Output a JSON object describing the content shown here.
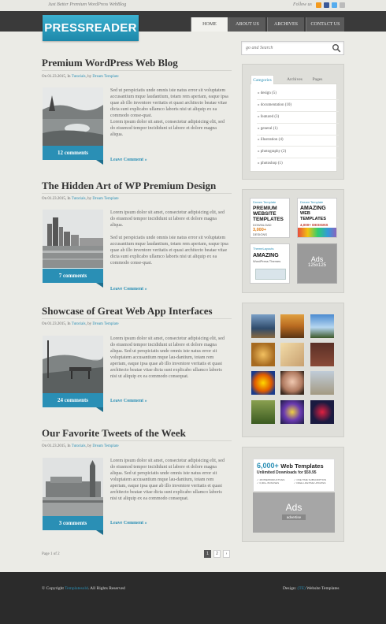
{
  "topbar": {
    "tagline": "Just Better Premium WordPress WebBlog",
    "follow_label": "Follow us"
  },
  "header": {
    "logo": "PRESSREADER",
    "nav": [
      {
        "label": "HOME"
      },
      {
        "label": "ABOUT US"
      },
      {
        "label": "ARCHIVES"
      },
      {
        "label": "CONTACT US"
      }
    ]
  },
  "search": {
    "placeholder": "go and Search"
  },
  "posts": [
    {
      "title": "Premium WordPress Web Blog",
      "date": "On 01.23.2015, In",
      "category": "Tutorials",
      "by": ", by",
      "author": "Dream Template",
      "comments": "12 comments",
      "paragraphs": [
        "Sed ut perspiciatis unde omnis iste natus error sit voluptatem accusantium mque laudantium, totam rem aperiam, eaque ipsa quae ab illo inventore veritatis et quasi architecto beatae vitae dicta sunt explicabo ullamco laboris nisi ut aliquip ex ea commodo conse-quat.",
        "Lorem ipsum dolor sit amet, consectetur adipisicing elit, sed do eiusmod tempor incididunt ut labore et dolore magna aliqua."
      ],
      "leave": "Leave Comment »"
    },
    {
      "title": "The Hidden Art of WP Premium Design",
      "date": "On 01.23.2015, In",
      "category": "Tutorials",
      "by": ", by",
      "author": "Dream Template",
      "comments": "7 comments",
      "paragraphs": [
        "Lorem ipsum dolor sit amet, consectetur adipisicing elit, sed do eiusmod tempor incididunt ut labore et dolore magna aliqua.",
        "Sed ut perspiciatis unde omnis iste natus error sit voluptatem accusantium mque laudantium, totam rem aperiam, eaque ipsa quae ab illo inventore veritatis et quasi architecto beatae vitae dicta sunt explicabo ullamco laboris nisi ut aliquip ex ea commodo conse-quat."
      ],
      "leave": "Leave Comment »"
    },
    {
      "title": "Showcase of Great Web App Interfaces",
      "date": "On 01.23.2015, In",
      "category": "Tutorials",
      "by": ", by",
      "author": "Dream Template",
      "comments": "24 comments",
      "paragraphs": [
        "Lorem ipsum dolor sit amet, consectetur adipisicing elit, sed do eiusmod tempor incididunt ut labore et dolore magna aliqua. Sed ut perspiciatis unde omnis iste natus error sit voluptatem accusantium mque lau-dantium, totam rem aperiam, eaque ipsa quae ab illo inventore veritatis et quasi architecto beatae vitae dicta sunt explicabo ullamco laboris nisi ut aliquip ex ea commodo consequat."
      ],
      "leave": "Leave Comment »"
    },
    {
      "title": "Our Favorite Tweets of the Week",
      "date": "On 01.23.2015, In",
      "category": "Tutorials",
      "by": ", by",
      "author": "Dream Template",
      "comments": "3 comments",
      "paragraphs": [
        "Lorem ipsum dolor sit amet, consectetur adipisicing elit, sed do eiusmod tempor incididunt ut labore et dolore magna aliqua. Sed ut perspiciatis unde omnis iste natus error sit voluptatem accusantium mque lau-dantium, totam rem aperiam, eaque ipsa quae ab illo inventore veritatis et quasi architecto beatae vitae dicta sunt explicabo ullamco laboris nisi ut aliquip ex ea commodo consequat."
      ],
      "leave": "Leave Comment »"
    }
  ],
  "pagination": {
    "info": "Page 1 of 2",
    "pages": [
      "1",
      "2",
      "›"
    ]
  },
  "sidebar": {
    "tabs": [
      "Categories",
      "Archives",
      "Pages"
    ],
    "categories": [
      "» design (5)",
      "» documentation (10)",
      "» featured (3)",
      "» general (1)",
      "» illustration (4)",
      "» photography (2)",
      "» photoshop (1)"
    ],
    "ads": [
      {
        "small": "Dream Template",
        "lines": [
          "PREMIUM",
          "WEBSITE",
          "TEMPLATES"
        ],
        "sub": "DOWNLOAD",
        "num": "3,000+",
        "tail": "DESIGNS"
      },
      {
        "small": "Dream Template",
        "lines": [
          "AMAZING",
          "WEB TEMPLATES"
        ],
        "num": "4,000+ DESIGNS",
        "sub": "UNLIMITED DOWNLOADS"
      },
      {
        "small": "ThemeLayouts",
        "lines": [
          "AMAZING"
        ],
        "sub": "WordPress Themes"
      },
      {
        "label": "Ads",
        "size": "125x125"
      }
    ],
    "banner": {
      "headline_num": "6,000+",
      "headline": "Web Templates",
      "sub": "Unlimited Downloads for $59.95",
      "fine": [
        "✓ 48 PREPRODUCTIVES",
        "✓ 6,000+ BONUSES",
        "✓ ONE TIME SUBSCRIPTION",
        "✓ FREE LIFETIME UPDATES"
      ],
      "ads_label": "Ads",
      "advertise": "advertise"
    }
  },
  "footer": {
    "copy_prefix": "© Copyright",
    "copy_link": "Templatesold",
    "copy_suffix": ". All Rights Reserved",
    "design_prefix": "Design:",
    "design_link": "(TE)",
    "design_suffix": "Website Templates"
  },
  "colors": {
    "accent": "#2a8fb5",
    "header_dark": "#3a3a3a",
    "background": "#ebebe6",
    "footer": "#2b2b2b"
  }
}
